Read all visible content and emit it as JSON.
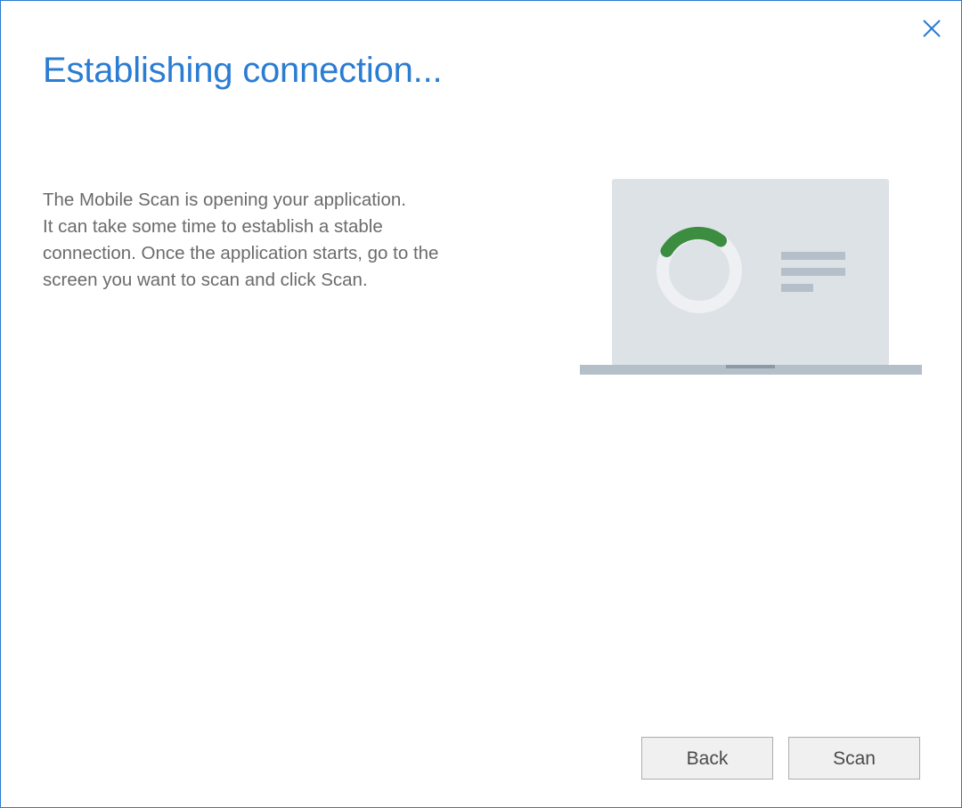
{
  "dialog": {
    "title": "Establishing connection...",
    "description_lines": [
      "The Mobile Scan is opening your application.",
      "It can take some time to establish a stable",
      "connection. Once the application starts, go to the",
      "screen you want to scan and click Scan."
    ],
    "close_icon": "close-icon",
    "illustration_icon": "laptop-loading-icon"
  },
  "buttons": {
    "back_label": "Back",
    "scan_label": "Scan"
  },
  "colors": {
    "accent": "#2b7cd3",
    "spinner": "#3c8d3f",
    "laptop_screen": "#dde2e7",
    "laptop_base": "#b5bfca"
  }
}
